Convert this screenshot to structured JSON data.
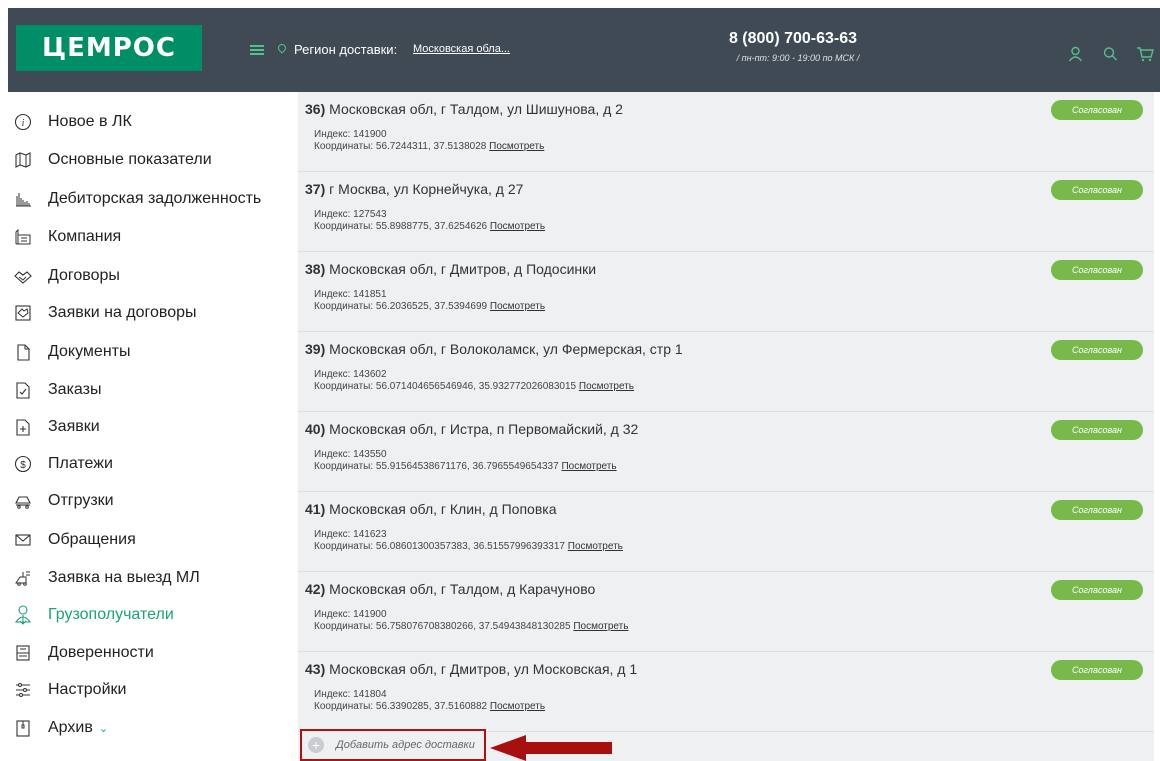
{
  "header": {
    "logo": "ЦЕМРОС",
    "region_label": "Регион доставки:",
    "region_value": "Московская обла...",
    "phone": "8 (800) 700-63-63",
    "hours": "/ пн-пт: 9:00 - 19:00 по МСК /",
    "icons": [
      "menu-icon",
      "location-pin-icon",
      "user-icon",
      "search-icon",
      "cart-icon"
    ]
  },
  "sidebar": {
    "items": [
      {
        "label": "Новое в ЛК",
        "icon": "info-icon"
      },
      {
        "label": "Основные показатели",
        "icon": "map-icon"
      },
      {
        "label": "Дебиторская задолженность",
        "icon": "bar-chart-icon"
      },
      {
        "label": "Компания",
        "icon": "factory-icon"
      },
      {
        "label": "Договоры",
        "icon": "handshake-icon"
      },
      {
        "label": "Заявки на договоры",
        "icon": "contract-request-icon"
      },
      {
        "label": "Документы",
        "icon": "documents-icon"
      },
      {
        "label": "Заказы",
        "icon": "order-check-icon"
      },
      {
        "label": "Заявки",
        "icon": "request-plus-icon"
      },
      {
        "label": "Платежи",
        "icon": "dollar-icon"
      },
      {
        "label": "Отгрузки",
        "icon": "cement-mixer-icon"
      },
      {
        "label": "Обращения",
        "icon": "envelope-icon"
      },
      {
        "label": "Заявка на выезд МЛ",
        "icon": "lab-visit-icon"
      },
      {
        "label": "Грузополучатели",
        "icon": "consignee-user-icon"
      },
      {
        "label": "Доверенности",
        "icon": "power-of-attorney-icon"
      },
      {
        "label": "Настройки",
        "icon": "sliders-icon"
      },
      {
        "label": "Архив",
        "icon": "archive-icon"
      }
    ],
    "active_item": "Грузополучатели",
    "archive_chevron": "chevron-down-icon"
  },
  "addresses": [
    {
      "num": "36)",
      "address": "Московская обл, г Талдом, ул Шишунова, д 2",
      "index": "Индекс: 141900",
      "coords": "Координаты: 56.7244311, 37.5138028",
      "link": "Посмотреть",
      "status": "Согласован"
    },
    {
      "num": "37)",
      "address": "г Москва, ул Корнейчука, д 27",
      "index": "Индекс: 127543",
      "coords": "Координаты: 55.8988775, 37.6254626",
      "link": "Посмотреть",
      "status": "Согласован"
    },
    {
      "num": "38)",
      "address": "Московская обл, г Дмитров, д Подосинки",
      "index": "Индекс: 141851",
      "coords": "Координаты: 56.2036525, 37.5394699",
      "link": "Посмотреть",
      "status": "Согласован"
    },
    {
      "num": "39)",
      "address": "Московская обл, г Волоколамск, ул Фермерская, стр 1",
      "index": "Индекс: 143602",
      "coords": "Координаты: 56.071404656546946, 35.932772026083015",
      "link": "Посмотреть",
      "status": "Согласован"
    },
    {
      "num": "40)",
      "address": "Московская обл, г Истра, п Первомайский, д 32",
      "index": "Индекс: 143550",
      "coords": "Координаты: 55.91564538671176, 36.7965549654337",
      "link": "Посмотреть",
      "status": "Согласован"
    },
    {
      "num": "41)",
      "address": "Московская обл, г Клин, д Поповка",
      "index": "Индекс: 141623",
      "coords": "Координаты: 56.08601300357383, 36.51557996393317",
      "link": "Посмотреть",
      "status": "Согласован"
    },
    {
      "num": "42)",
      "address": "Московская обл, г Талдом, д Карачуново",
      "index": "Индекс: 141900",
      "coords": "Координаты: 56.758076708380266, 37.54943848130285",
      "link": "Посмотреть",
      "status": "Согласован"
    },
    {
      "num": "43)",
      "address": "Московская обл, г Дмитров, ул Московская, д 1",
      "index": "Индекс: 141804",
      "coords": "Координаты: 56.3390285, 37.5160882",
      "link": "Посмотреть",
      "status": "Согласован"
    }
  ],
  "add_address": {
    "label": "Добавить адрес доставки",
    "icon": "plus-circle-icon"
  },
  "colors": {
    "header_bg": "#3f4a54",
    "brand_green": "#008e66",
    "accent": "#55c08c",
    "active": "#1aa37a",
    "badge": "#79b84a",
    "highlight": "#b01212"
  }
}
